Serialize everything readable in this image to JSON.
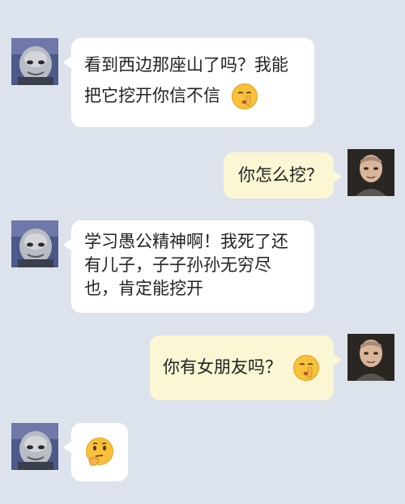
{
  "messages": [
    {
      "side": "left",
      "sender": "stone-creature",
      "lines": [
        "看到西边那座山了吗？我能",
        "把它挖开你信不信"
      ],
      "trailing_emoji": "shush-face-emoji"
    },
    {
      "side": "right",
      "sender": "old-man",
      "lines": [
        "你怎么挖？"
      ],
      "trailing_emoji": ""
    },
    {
      "side": "left",
      "sender": "stone-creature",
      "lines": [
        "学习愚公精神啊！我死了还",
        "有儿子，子子孙孙无穷尽",
        "也，肯定能挖开"
      ],
      "trailing_emoji": ""
    },
    {
      "side": "right",
      "sender": "old-man",
      "lines": [
        "你有女朋友吗？"
      ],
      "trailing_emoji": "shush-face-emoji"
    },
    {
      "side": "left",
      "sender": "stone-creature",
      "lines": [],
      "trailing_emoji": "thinking-face-emoji"
    }
  ],
  "colors": {
    "background": "#dde3ec",
    "left_bubble": "#ffffff",
    "right_bubble": "#fbf6d3"
  }
}
